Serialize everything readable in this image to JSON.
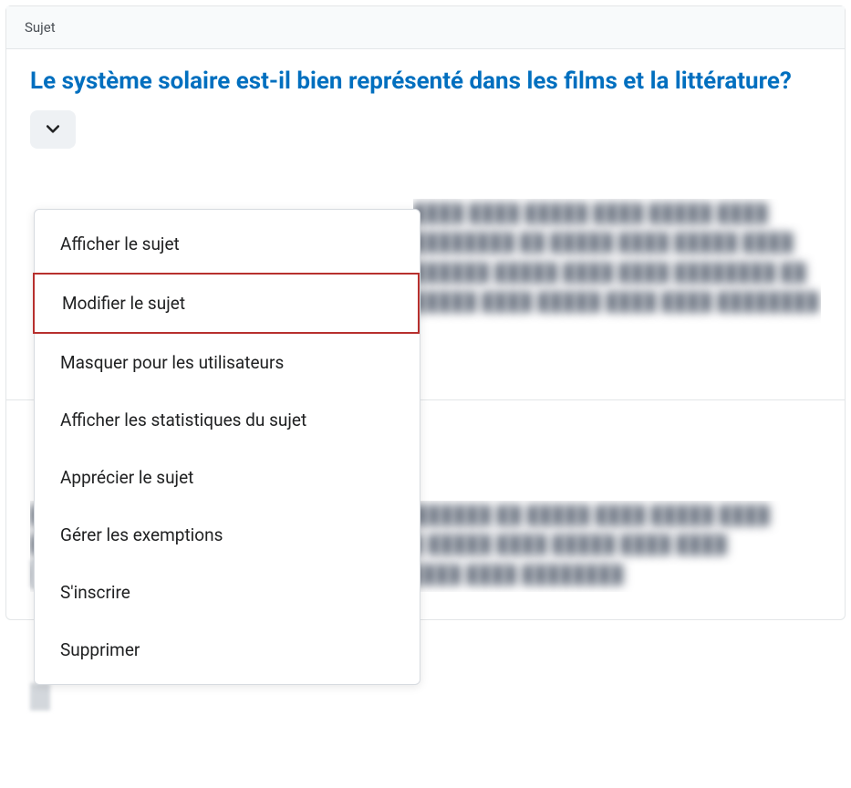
{
  "header": {
    "label": "Sujet"
  },
  "topic": {
    "title": "Le système solaire est-il bien représenté dans les films et la littérature?"
  },
  "menu": {
    "items": [
      {
        "label": "Afficher le sujet"
      },
      {
        "label": "Modifier le sujet"
      },
      {
        "label": "Masquer pour les utilisateurs"
      },
      {
        "label": "Afficher les statistiques du sujet"
      },
      {
        "label": "Apprécier le sujet"
      },
      {
        "label": "Gérer les exemptions"
      },
      {
        "label": "S'inscrire"
      },
      {
        "label": "Supprimer"
      }
    ],
    "highlighted_index": 1
  },
  "placeholder": {
    "block1": "████ ████ █████ ████ █████ ████ ████████ ██ █████ ████ █████ ████ ██████ █████ ████ ████ ████████ ██ █████ ████ █████ ████ ████ ████████",
    "block2": "████ ████ █████ ████ █████ ████ ████████ ██ █████ ████ █████ ████ ██████ █████ ████ ████ ████████ ██ █████ ████ █████ ████ ████ ████████ █████ ████ ██████ █████ ████ ████ ████████"
  }
}
